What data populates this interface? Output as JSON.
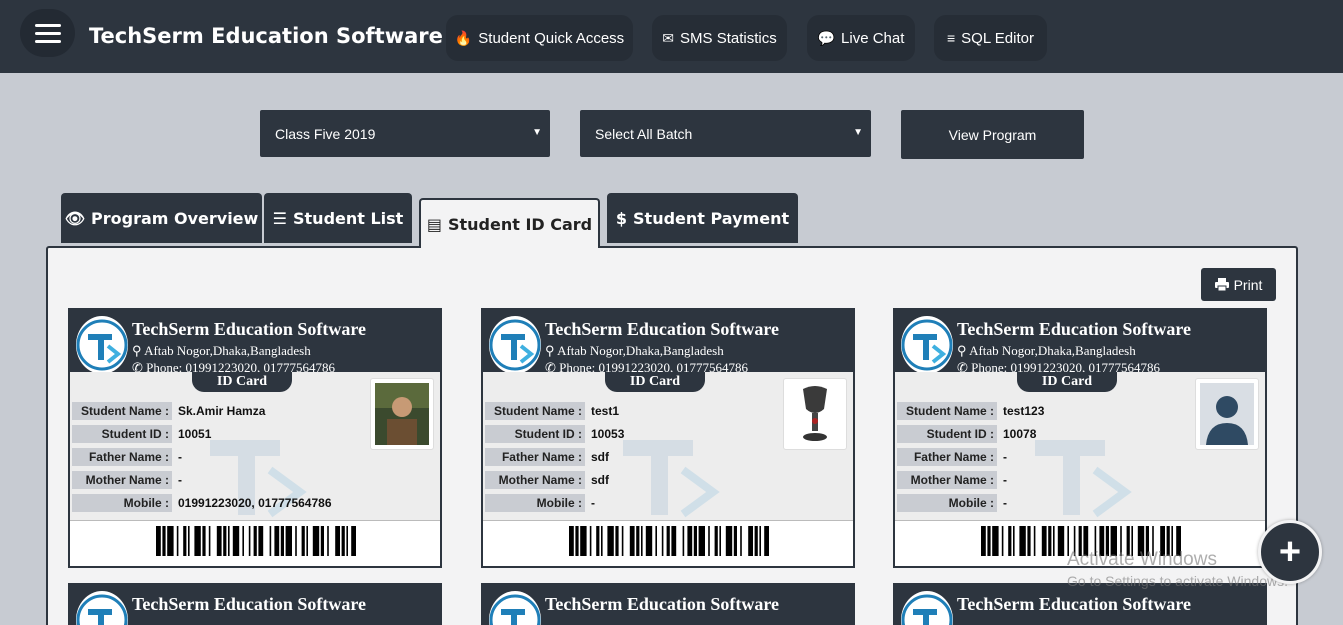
{
  "app": {
    "brand": "TechSerm Education Software"
  },
  "nav": [
    {
      "label": "Student Quick Access",
      "icon": "fire-icon",
      "glyph": "🔥"
    },
    {
      "label": "SMS Statistics",
      "icon": "envelope-icon",
      "glyph": "✉"
    },
    {
      "label": "Live Chat",
      "icon": "chat-icon",
      "glyph": "💬"
    },
    {
      "label": "SQL Editor",
      "icon": "database-icon",
      "glyph": "≡"
    }
  ],
  "filters": {
    "class_select": "Class Five 2019",
    "batch_select": "Select All Batch",
    "view_button": "View Program"
  },
  "tabs": [
    {
      "label": "Program Overview",
      "glyph": "👁"
    },
    {
      "label": "Student List",
      "glyph": "☰"
    },
    {
      "label": "Student ID Card",
      "glyph": "▤"
    },
    {
      "label": "Student Payment",
      "glyph": "$"
    }
  ],
  "print_label": "Print",
  "card_template": {
    "org": "TechSerm Education Software",
    "address": "Aftab Nogor,Dhaka,Bangladesh",
    "phone": "Phone: 01991223020, 01777564786",
    "id_label": "ID Card",
    "labels": {
      "name": "Student Name :",
      "id": "Student ID :",
      "father": "Father Name :",
      "mother": "Mother Name :",
      "mobile": "Mobile :"
    }
  },
  "cards": [
    {
      "name": "Sk.Amir Hamza",
      "id": "10051",
      "father": "-",
      "mother": "-",
      "mobile": "01991223020, 01777564786"
    },
    {
      "name": "test1",
      "id": "10053",
      "father": "sdf",
      "mother": "sdf",
      "mobile": "-"
    },
    {
      "name": "test123",
      "id": "10078",
      "father": "-",
      "mother": "-",
      "mobile": "-"
    }
  ],
  "second_row_titles": [
    "TechSerm Education Software",
    "TechSerm Education Software",
    "TechSerm Education Software"
  ],
  "windows_watermark": {
    "line1": "Activate Windows",
    "line2": "Go to Settings to activate Windows."
  },
  "fab_label": "+"
}
